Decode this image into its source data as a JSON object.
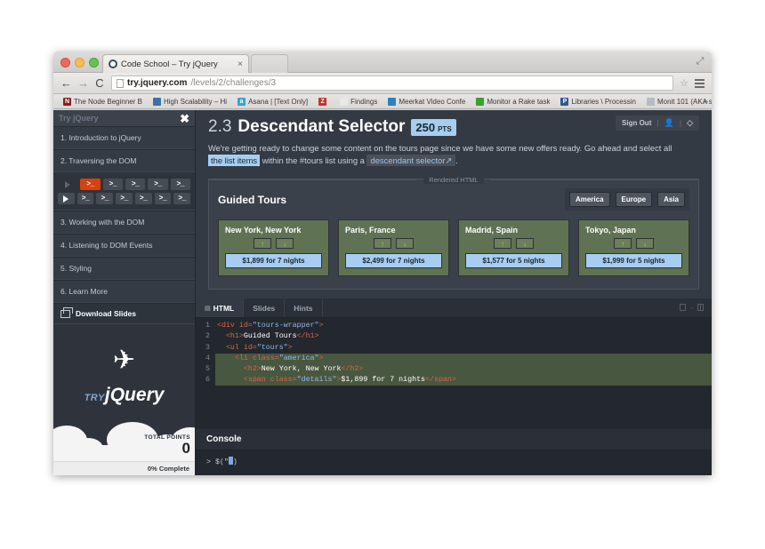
{
  "browser": {
    "tab_title": "Code School – Try jQuery",
    "tab_close": "×",
    "nav": {
      "back": "←",
      "forward": "→",
      "reload": "C"
    },
    "url_host": "try.jquery.com",
    "url_path": "/levels/2/challenges/3",
    "star_icon": "☆",
    "maximize_icon": "⤢",
    "bookmarks": [
      {
        "icon_text": "N",
        "icon_color": "#8b1f1f",
        "label": "The Node Beginner B"
      },
      {
        "icon_text": "",
        "icon_color": "#3d6fa8",
        "label": "High Scalability – Hi"
      },
      {
        "icon_text": "a",
        "icon_color": "#3ca2c8",
        "label": "Asana | [Text Only] "
      },
      {
        "icon_text": "Z",
        "icon_color": "#c8322c",
        "label": ""
      },
      {
        "icon_text": "",
        "icon_color": "#e8e8e8",
        "label": "Findings"
      },
      {
        "icon_text": "",
        "icon_color": "#2f7fc1",
        "label": "Meerkat Video Confe"
      },
      {
        "icon_text": "",
        "icon_color": "#3aa02f",
        "label": "Monitor a Rake task"
      },
      {
        "icon_text": "P",
        "icon_color": "#2d5a8e",
        "label": "Libraries \\ Processin"
      },
      {
        "icon_text": "",
        "icon_color": "#b6bcc2",
        "label": "Monit 101 (AKA syst"
      }
    ],
    "bookmarks_overflow": "»"
  },
  "sidebar": {
    "title": "Try jQuery",
    "close_label": "✖",
    "items": [
      {
        "label": "1. Introduction to jQuery"
      },
      {
        "label": "2. Traversing the DOM"
      },
      {
        "label": "3. Working with the DOM"
      },
      {
        "label": "4. Listening to DOM Events"
      },
      {
        "label": "5. Styling"
      },
      {
        "label": "6. Learn More"
      }
    ],
    "download_slides": "Download Slides",
    "steps_row1": [
      "play-dim",
      "term-active",
      "term",
      "term",
      "term",
      "term"
    ],
    "steps_row2": [
      "play",
      "term",
      "term",
      "term",
      "term",
      "term",
      "term"
    ],
    "terminal_glyph": ">_",
    "logo_try": "TRY",
    "logo_jquery": "jQuery",
    "plane_icon": "✈",
    "total_points_label": "TOTAL POINTS",
    "total_points_value": "0",
    "progress_label": "0% Complete"
  },
  "challenge": {
    "number": "2.3",
    "name": "Descendant Selector",
    "points_value": "250",
    "points_label": "PTS",
    "desc_part1": "We're getting ready to change some content on the tours page since we have some new offers ready. Go ahead and select all ",
    "desc_highlight": "the list items",
    "desc_part2": " within the #tours list using a ",
    "desc_code": "descendant selector",
    "desc_code_suffix": "↗",
    "desc_part3": ".",
    "sign_out": "Sign Out",
    "account_icon": "👤",
    "code_icon": "◇"
  },
  "rendered": {
    "legend": "Rendered HTML",
    "heading": "Guided Tours",
    "filters": [
      "America",
      "Europe",
      "Asia"
    ],
    "arrow_up": "↑",
    "arrow_down": "↓",
    "tours": [
      {
        "name": "New York, New York",
        "price": "$1,899 for 7 nights"
      },
      {
        "name": "Paris, France",
        "price": "$2,499 for 7 nights"
      },
      {
        "name": "Madrid, Spain",
        "price": "$1,577 for 5 nights"
      },
      {
        "name": "Tokyo, Japan",
        "price": "$1,999 for 5 nights"
      }
    ]
  },
  "editor": {
    "tabs": [
      {
        "label": "HTML",
        "active": true,
        "locked": true
      },
      {
        "label": "Slides",
        "active": false,
        "locked": false
      },
      {
        "label": "Hints",
        "active": false,
        "locked": false
      }
    ],
    "lock_icon": "🔒",
    "layout_arrow": "→",
    "lines": [
      {
        "n": "1",
        "selected": false,
        "segments": [
          {
            "t": "<div id=",
            "c": "tagc"
          },
          {
            "t": "\"tours-wrapper\"",
            "c": "strc"
          },
          {
            "t": ">",
            "c": "tagc"
          }
        ]
      },
      {
        "n": "2",
        "selected": false,
        "segments": [
          {
            "t": "  <h1>",
            "c": "tagc"
          },
          {
            "t": "Guided Tours",
            "c": "txtc"
          },
          {
            "t": "</h1>",
            "c": "tagc"
          }
        ]
      },
      {
        "n": "3",
        "selected": false,
        "segments": [
          {
            "t": "  <ul id=",
            "c": "tagc"
          },
          {
            "t": "\"tours\"",
            "c": "strc"
          },
          {
            "t": ">",
            "c": "tagc"
          }
        ]
      },
      {
        "n": "4",
        "selected": true,
        "segments": [
          {
            "t": "    <li class=",
            "c": "tagc"
          },
          {
            "t": "\"america\"",
            "c": "strc"
          },
          {
            "t": ">",
            "c": "tagc"
          }
        ]
      },
      {
        "n": "5",
        "selected": true,
        "segments": [
          {
            "t": "      <h2>",
            "c": "tagc"
          },
          {
            "t": "New York, New York",
            "c": "txtc"
          },
          {
            "t": "</h2>",
            "c": "tagc"
          }
        ]
      },
      {
        "n": "6",
        "selected": true,
        "segments": [
          {
            "t": "      <span class=",
            "c": "tagc"
          },
          {
            "t": "\"details\"",
            "c": "strc"
          },
          {
            "t": ">",
            "c": "tagc"
          },
          {
            "t": "$1,899 for 7 nights",
            "c": "txtc"
          },
          {
            "t": "</span>",
            "c": "tagc"
          }
        ]
      }
    ]
  },
  "console": {
    "title": "Console",
    "prompt": "> ",
    "input_before": "$(\"",
    "input_after": ")"
  }
}
